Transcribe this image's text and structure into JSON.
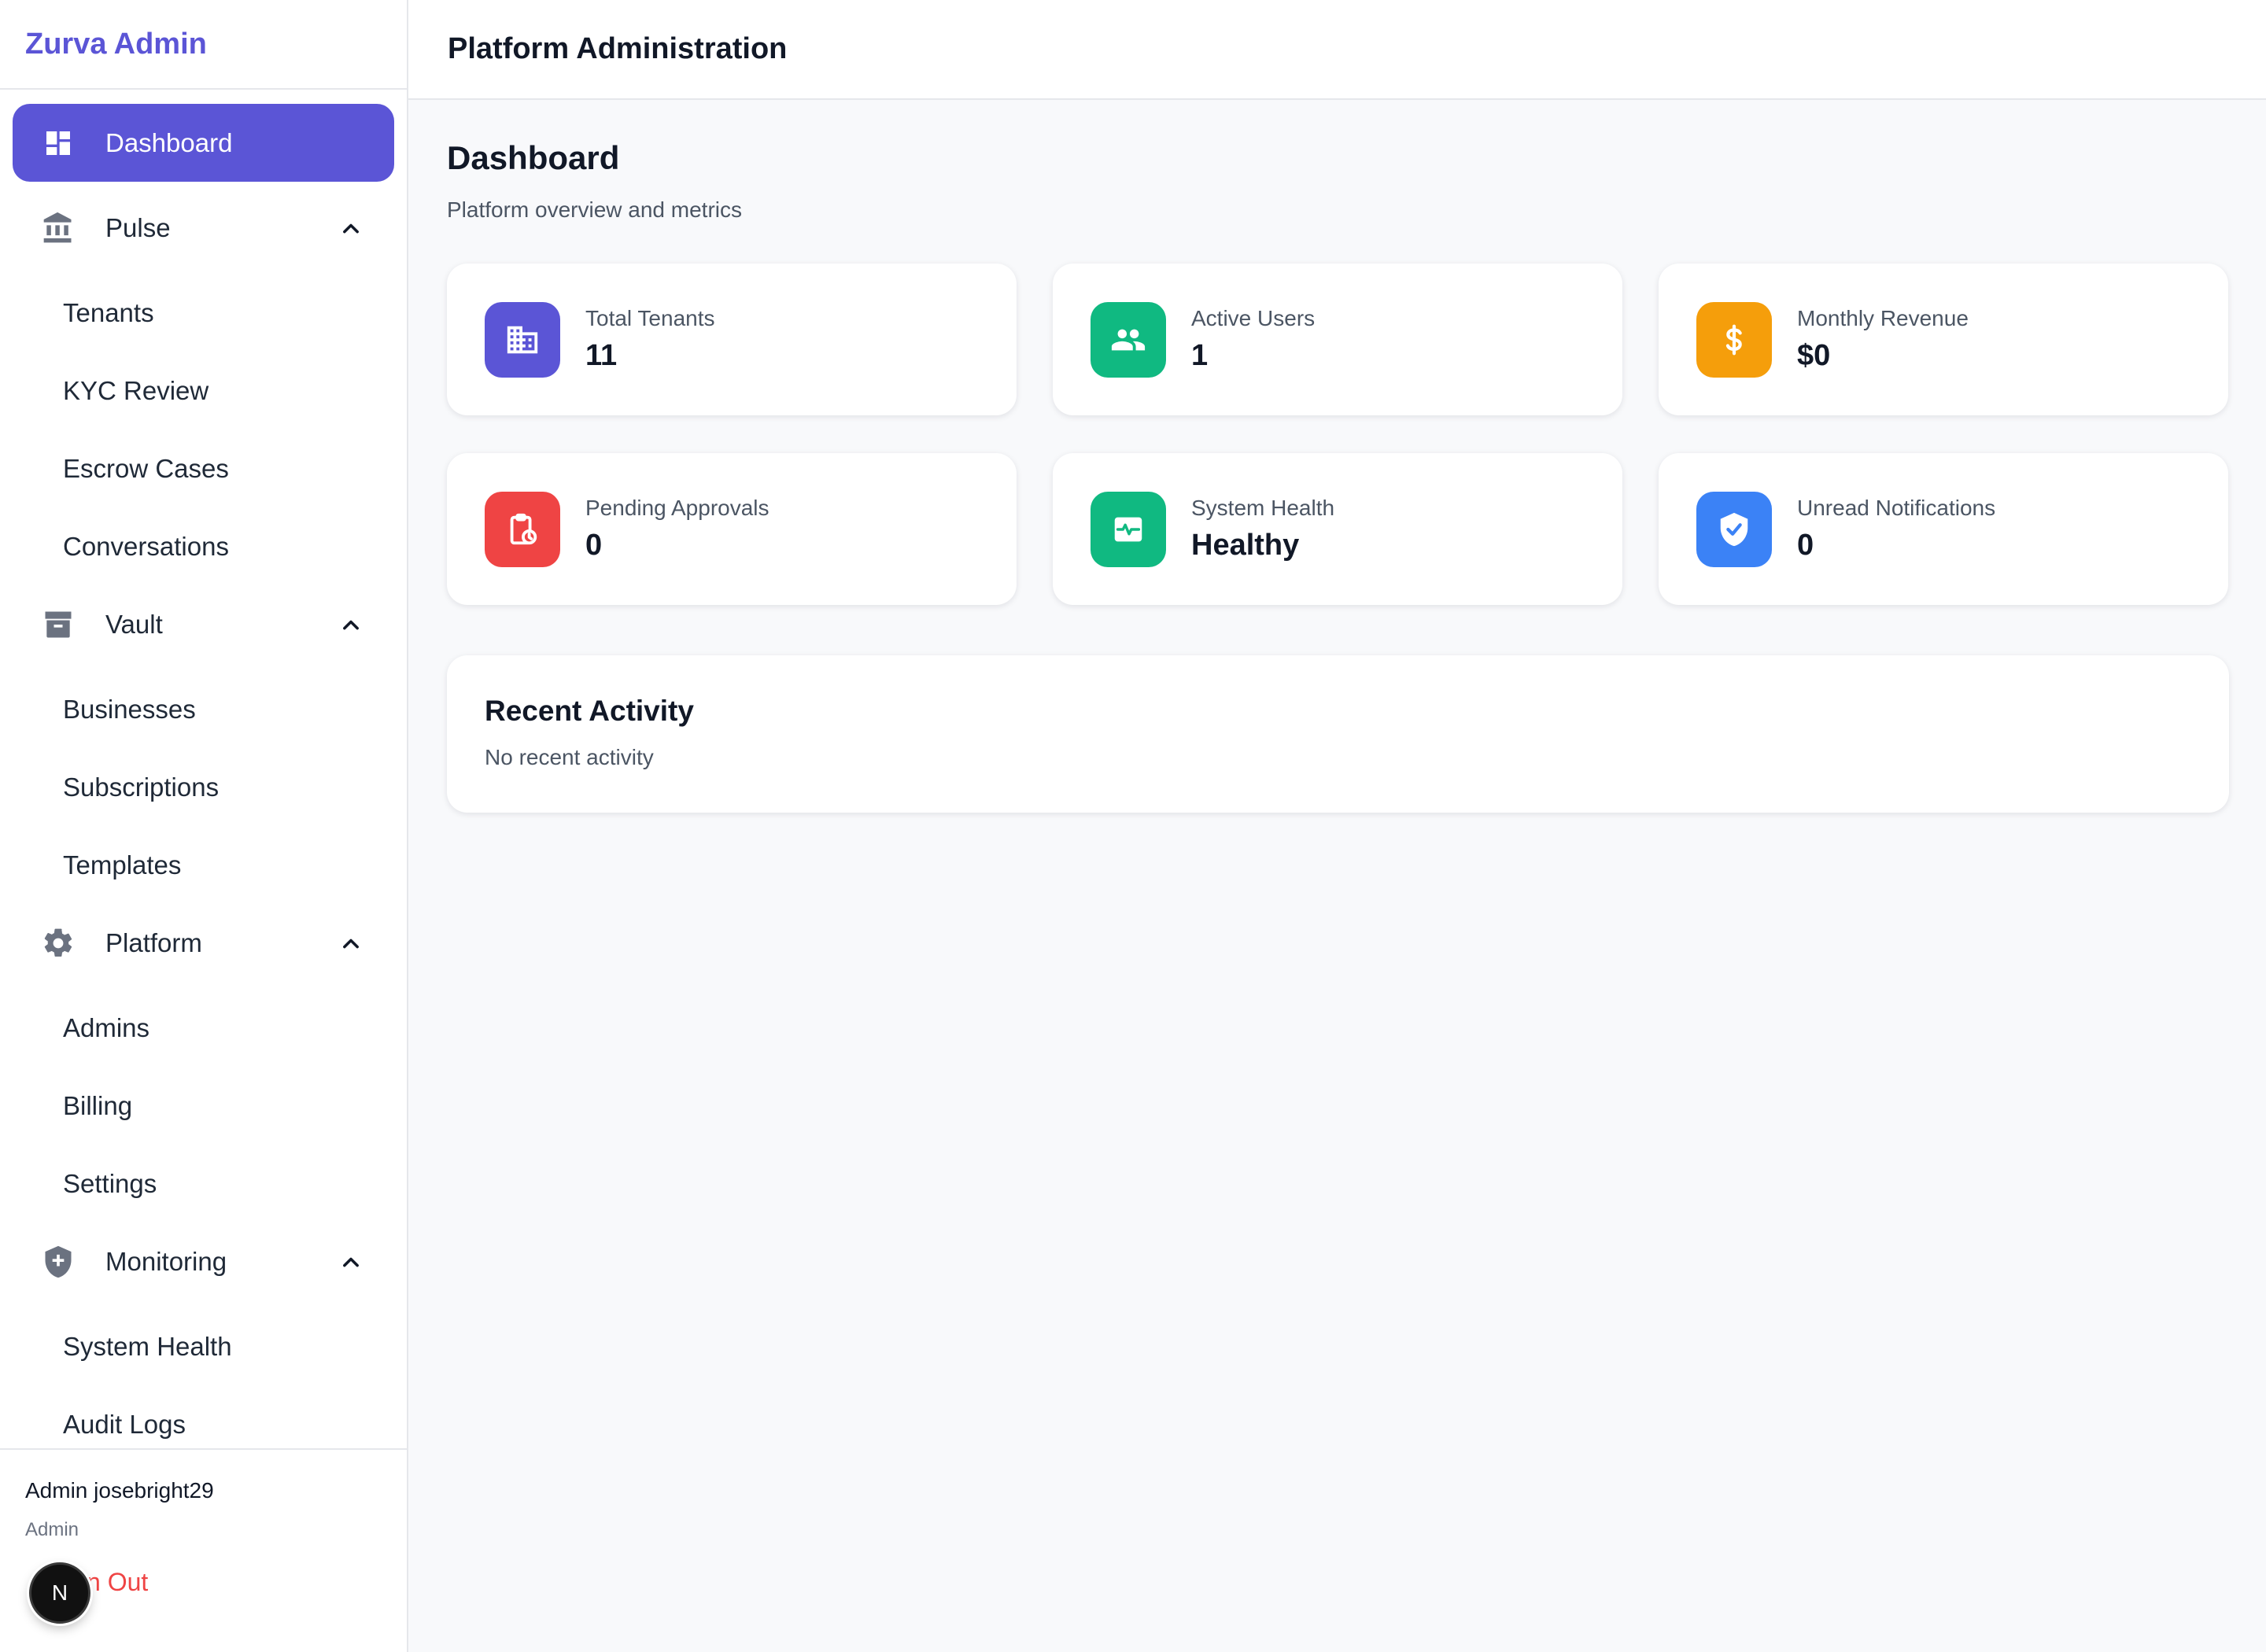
{
  "brand": "Zurva Admin",
  "topbar": {
    "title": "Platform Administration"
  },
  "sidebar": {
    "dashboard": {
      "label": "Dashboard",
      "icon": "dashboard-icon"
    },
    "sections": [
      {
        "label": "Pulse",
        "icon": "bank-icon",
        "items": [
          "Tenants",
          "KYC Review",
          "Escrow Cases",
          "Conversations"
        ]
      },
      {
        "label": "Vault",
        "icon": "archive-icon",
        "items": [
          "Businesses",
          "Subscriptions",
          "Templates"
        ]
      },
      {
        "label": "Platform",
        "icon": "gear-icon",
        "items": [
          "Admins",
          "Billing",
          "Settings"
        ]
      },
      {
        "label": "Monitoring",
        "icon": "shield-plus-icon",
        "items": [
          "System Health",
          "Audit Logs"
        ]
      }
    ],
    "user": {
      "name": "Admin josebright29",
      "role": "Admin",
      "signout_visible": "n Out"
    },
    "badge_letter": "N"
  },
  "page": {
    "title": "Dashboard",
    "subtitle": "Platform overview and metrics"
  },
  "stats": [
    {
      "label": "Total Tenants",
      "value": "11",
      "icon": "building-icon",
      "color": "#5b55d6"
    },
    {
      "label": "Active Users",
      "value": "1",
      "icon": "users-icon",
      "color": "#10b981"
    },
    {
      "label": "Monthly Revenue",
      "value": "$0",
      "icon": "dollar-icon",
      "color": "#f59e0b"
    },
    {
      "label": "Pending Approvals",
      "value": "0",
      "icon": "clipboard-clock-icon",
      "color": "#ef4444"
    },
    {
      "label": "System Health",
      "value": "Healthy",
      "icon": "pulse-monitor-icon",
      "color": "#10b981"
    },
    {
      "label": "Unread Notifications",
      "value": "0",
      "icon": "shield-check-icon",
      "color": "#3b82f6"
    }
  ],
  "activity": {
    "title": "Recent Activity",
    "empty": "No recent activity"
  },
  "colors": {
    "accent": "#5b55d6",
    "danger": "#ef4444",
    "muted_icon": "#6b7280"
  }
}
